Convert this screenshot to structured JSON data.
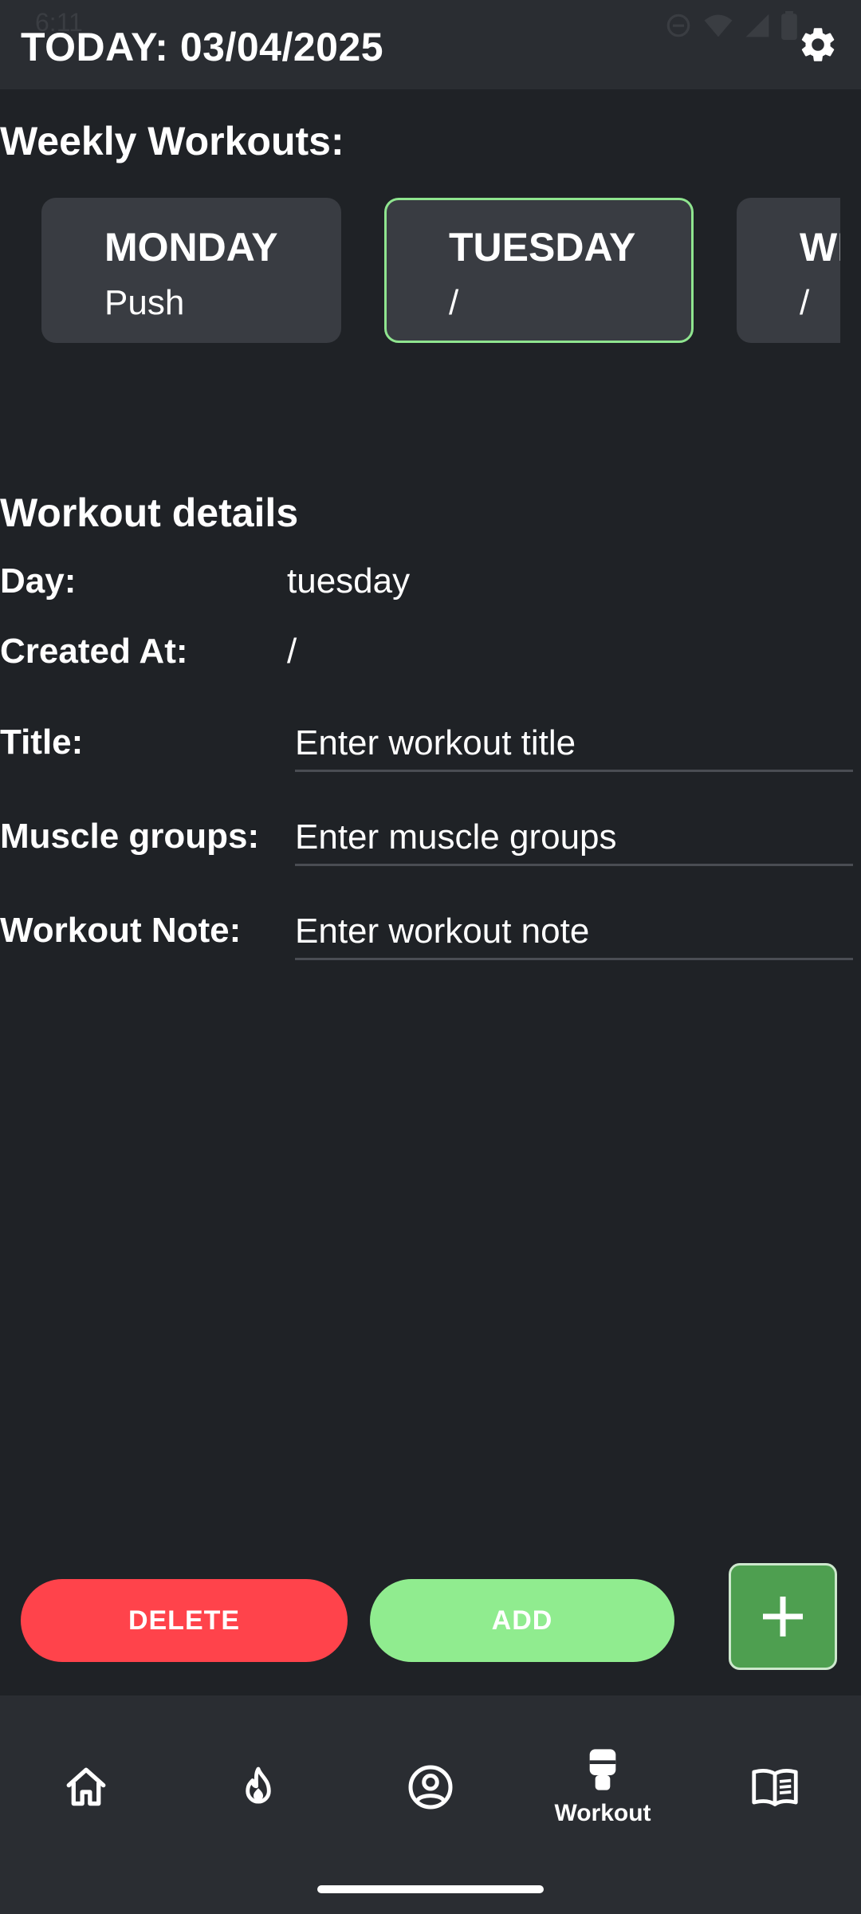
{
  "status_bar": {
    "time": "6:11"
  },
  "header": {
    "today": "TODAY: 03/04/2025",
    "settings_icon": "gear-icon"
  },
  "weekly": {
    "title": "Weekly Workouts:",
    "days": [
      {
        "name": "MONDAY",
        "sub": "Push",
        "selected": false
      },
      {
        "name": "TUESDAY",
        "sub": "/",
        "selected": true
      },
      {
        "name": "WEDNESDAY",
        "sub": "/",
        "selected": false
      }
    ]
  },
  "details": {
    "title": "Workout details",
    "day_label": "Day:",
    "day_value": "tuesday",
    "created_label": "Created At:",
    "created_value": "/",
    "title_label": "Title:",
    "title_placeholder": "Enter workout title",
    "muscle_label": "Muscle groups:",
    "muscle_placeholder": "Enter muscle groups",
    "note_label": "Workout Note:",
    "note_placeholder": "Enter workout note"
  },
  "actions": {
    "delete": "DELETE",
    "add": "ADD"
  },
  "nav": {
    "items": [
      {
        "icon": "home-icon"
      },
      {
        "icon": "flame-icon"
      },
      {
        "icon": "profile-icon"
      },
      {
        "icon": "workout-icon",
        "label": "Workout",
        "active": true
      },
      {
        "icon": "book-icon"
      }
    ]
  },
  "colors": {
    "background": "#1f2226",
    "bar": "#2a2d32",
    "card": "#393c42",
    "selected_border": "#8fe58f",
    "delete": "#ff434b",
    "add": "#90ec8f",
    "plus": "#4e9f50"
  }
}
